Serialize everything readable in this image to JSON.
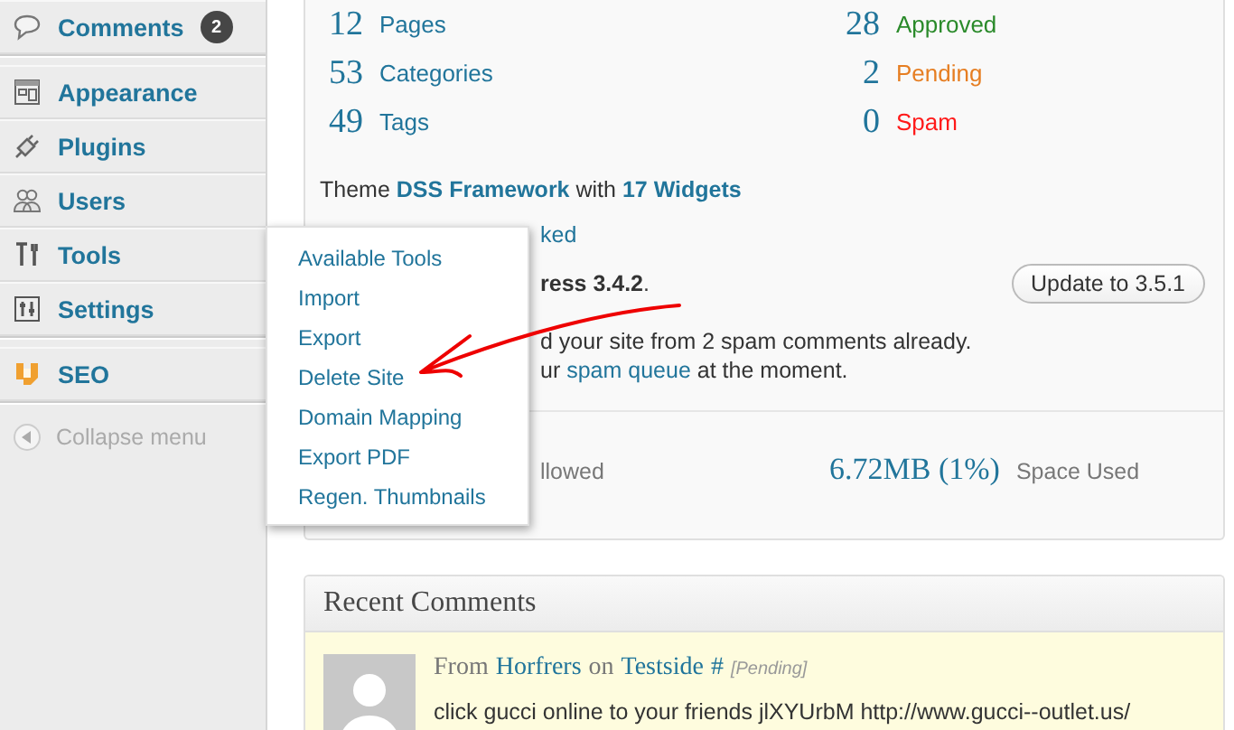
{
  "sidebar": {
    "groups": [
      [
        {
          "label": "Comments",
          "badge": "2"
        }
      ],
      [
        {
          "label": "Appearance"
        },
        {
          "label": "Plugins"
        },
        {
          "label": "Users"
        },
        {
          "label": "Tools"
        },
        {
          "label": "Settings"
        }
      ],
      [
        {
          "label": "SEO"
        }
      ]
    ],
    "collapse_label": "Collapse menu"
  },
  "tools_menu": {
    "items": [
      "Available Tools",
      "Import",
      "Export",
      "Delete Site",
      "Domain Mapping",
      "Export PDF",
      "Regen. Thumbnails"
    ]
  },
  "right_now": {
    "content_stats": [
      {
        "count": "12",
        "label": "Pages"
      },
      {
        "count": "53",
        "label": "Categories"
      },
      {
        "count": "49",
        "label": "Tags"
      }
    ],
    "discussion_stats": [
      {
        "count": "28",
        "label": "Approved",
        "color": "#2a8a2a"
      },
      {
        "count": "2",
        "label": "Pending",
        "color": "#e67e22"
      },
      {
        "count": "0",
        "label": "Spam",
        "color": "#ff1a1a"
      }
    ],
    "theme": {
      "prefix": "Theme",
      "name": "DSS Framework",
      "middle": "with",
      "widgets": "17 Widgets"
    },
    "covered_link_fragment": "ked",
    "version_fragment": "**ress 3.4.2**.",
    "update_button": "Update to 3.5.1",
    "spam_line_fragment": "d your site from 2 spam comments already.",
    "queue_line": {
      "prefix": "ur",
      "link": "spam queue",
      "suffix": "at the moment."
    },
    "storage": {
      "allowed_fragment": "llowed",
      "used_value": "6.72MB (1%)",
      "used_label": "Space Used"
    }
  },
  "recent_comments": {
    "title": "Recent Comments",
    "comments": [
      {
        "from": "From",
        "author": "Horfrers",
        "on": "on",
        "post": "Testside",
        "hash": "#",
        "status": "[Pending]",
        "excerpt": "click gucci online to your friends jlXYUrbM http://www.gucci--outlet.us/"
      }
    ]
  }
}
